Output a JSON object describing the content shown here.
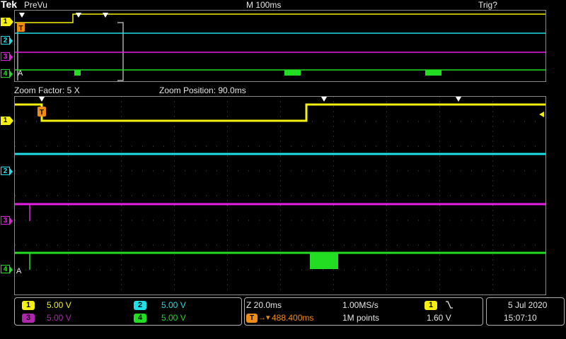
{
  "top": {
    "brand": "Tek",
    "mode": "PreVu",
    "timebase": "M 100ms",
    "status": "Trig?"
  },
  "zoom": {
    "factor": "Zoom Factor: 5 X",
    "position": "Zoom Position: 90.0ms"
  },
  "channels": [
    {
      "num": "1",
      "color": "#f5f010"
    },
    {
      "num": "2",
      "color": "#1ee0e6"
    },
    {
      "num": "3",
      "color": "#e61ee6"
    },
    {
      "num": "4",
      "color": "#22dd22"
    }
  ],
  "trigger_marker": "T",
  "ch4_label": "A",
  "readouts": {
    "ch1_scale": "5.00 V",
    "ch2_scale": "5.00 V",
    "ch3_scale": "5.00 V",
    "ch4_scale": "5.00 V",
    "zoom_timebase": "Z 20.0ms",
    "trigger_delay": "488.400ms",
    "sample_rate": "1.00MS/s",
    "record_length": "1M points",
    "trigger_source": "1",
    "trigger_slope_icon": "falling-edge-icon",
    "trigger_level": "1.60 V",
    "date": "5 Jul  2020",
    "time": "15:07:10"
  }
}
